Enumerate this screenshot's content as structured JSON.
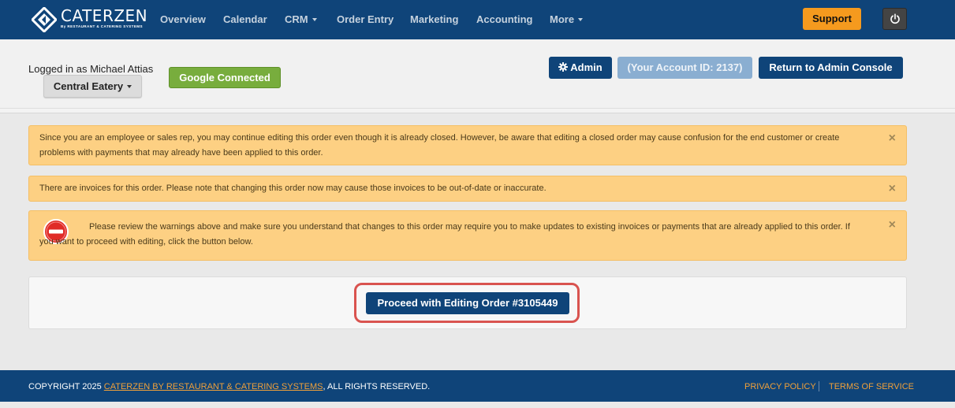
{
  "brand": {
    "name": "CATERZEN",
    "tagline": "By RESTAURANT & CATERING SYSTEMS",
    "logo_icon": "diamond-arrow-logo"
  },
  "nav": {
    "items": [
      {
        "label": "Overview"
      },
      {
        "label": "Calendar"
      },
      {
        "label": "CRM"
      },
      {
        "label": "Order Entry"
      },
      {
        "label": "Marketing"
      },
      {
        "label": "Accounting"
      },
      {
        "label": "More"
      }
    ],
    "support_label": "Support",
    "power_icon": "power-icon"
  },
  "header": {
    "logged_in_text": "Logged in as Michael Attias",
    "location_label": "Central Eatery",
    "google_label": "Google Connected",
    "admin_label": "Admin",
    "admin_icon": "gear-icon",
    "account_label": "(Your Account ID: 2137)",
    "return_label": "Return to Admin Console"
  },
  "alerts": [
    {
      "text": "Since you are an employee or sales rep, you may continue editing this order even though it is already closed. However, be aware that editing a closed order may cause confusion for the end customer or create problems with payments that may already have been applied to this order.",
      "close": "×"
    },
    {
      "text": "There are invoices for this order. Please note that changing this order now may cause those invoices to be out-of-date or inaccurate.",
      "close": "×"
    },
    {
      "text": "Please review the warnings above and make sure you understand that changes to this order may require you to make updates to existing invoices or payments that are already applied to this order. If you want to proceed with editing, click the button below.",
      "close": "×",
      "icon": "stop-icon"
    }
  ],
  "proceed": {
    "label": "Proceed with Editing Order #3105449"
  },
  "footer": {
    "copyright_prefix": "COPYRIGHT 2025 ",
    "company_link": "CATERZEN BY RESTAURANT & CATERING SYSTEMS",
    "copyright_suffix": ", ALL RIGHTS RESERVED.",
    "privacy_label": "PRIVACY POLICY",
    "terms_label": "TERMS OF SERVICE"
  },
  "colors": {
    "navbar": "#0f4479",
    "support": "#f59a1e",
    "google": "#78ad3d",
    "alert_bg": "#fdd083",
    "highlight": "#d9534f",
    "footer_link": "#f0a03a"
  }
}
